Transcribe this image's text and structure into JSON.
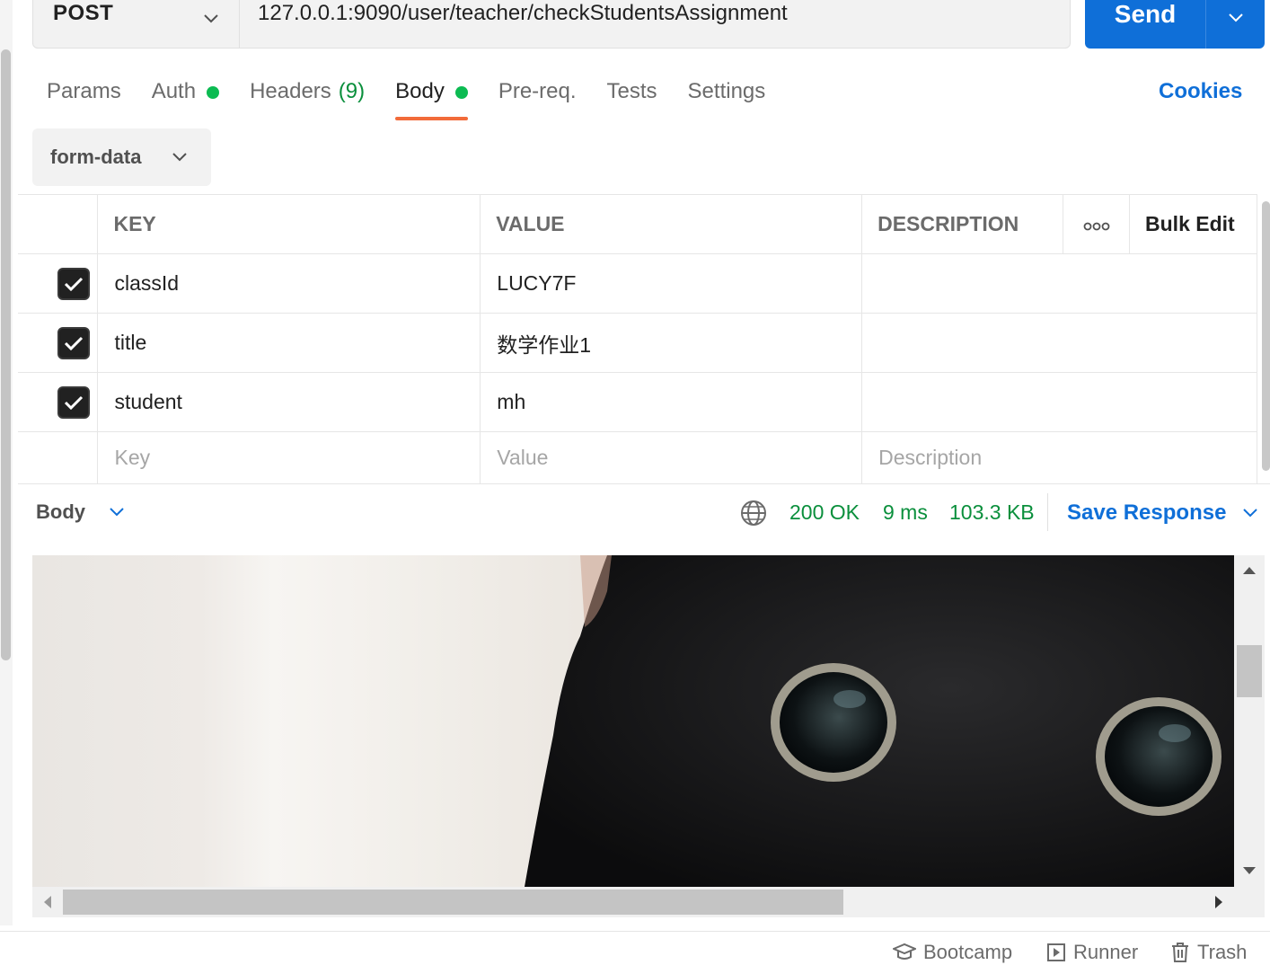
{
  "request": {
    "method": "POST",
    "url": "127.0.0.1:9090/user/teacher/checkStudentsAssignment",
    "send_label": "Send"
  },
  "tabs": [
    {
      "label": "Params",
      "dot": false
    },
    {
      "label": "Auth",
      "dot": true
    },
    {
      "label": "Headers",
      "count": "(9)"
    },
    {
      "label": "Body",
      "dot": true,
      "active": true
    },
    {
      "label": "Pre-req."
    },
    {
      "label": "Tests"
    },
    {
      "label": "Settings"
    }
  ],
  "cookies_label": "Cookies",
  "body_type": "form-data",
  "params_table": {
    "headers": {
      "key": "KEY",
      "value": "VALUE",
      "description": "DESCRIPTION",
      "bulk_edit": "Bulk Edit"
    },
    "rows": [
      {
        "checked": true,
        "key": "classId",
        "value": "LUCY7F",
        "description": ""
      },
      {
        "checked": true,
        "key": "title",
        "value": "数学作业1",
        "description": ""
      },
      {
        "checked": true,
        "key": "student",
        "value": "mh",
        "description": ""
      }
    ],
    "placeholders": {
      "key": "Key",
      "value": "Value",
      "description": "Description"
    }
  },
  "response": {
    "view_label": "Body",
    "status": "200 OK",
    "time": "9 ms",
    "size": "103.3 KB",
    "save_label": "Save Response"
  },
  "footer": {
    "bootcamp": "Bootcamp",
    "runner": "Runner",
    "trash": "Trash"
  },
  "colors": {
    "accent_blue": "#0f6fd8",
    "success_green": "#0a8f3c",
    "active_tab_orange": "#f26b3a",
    "status_dot": "#0cbb52"
  }
}
